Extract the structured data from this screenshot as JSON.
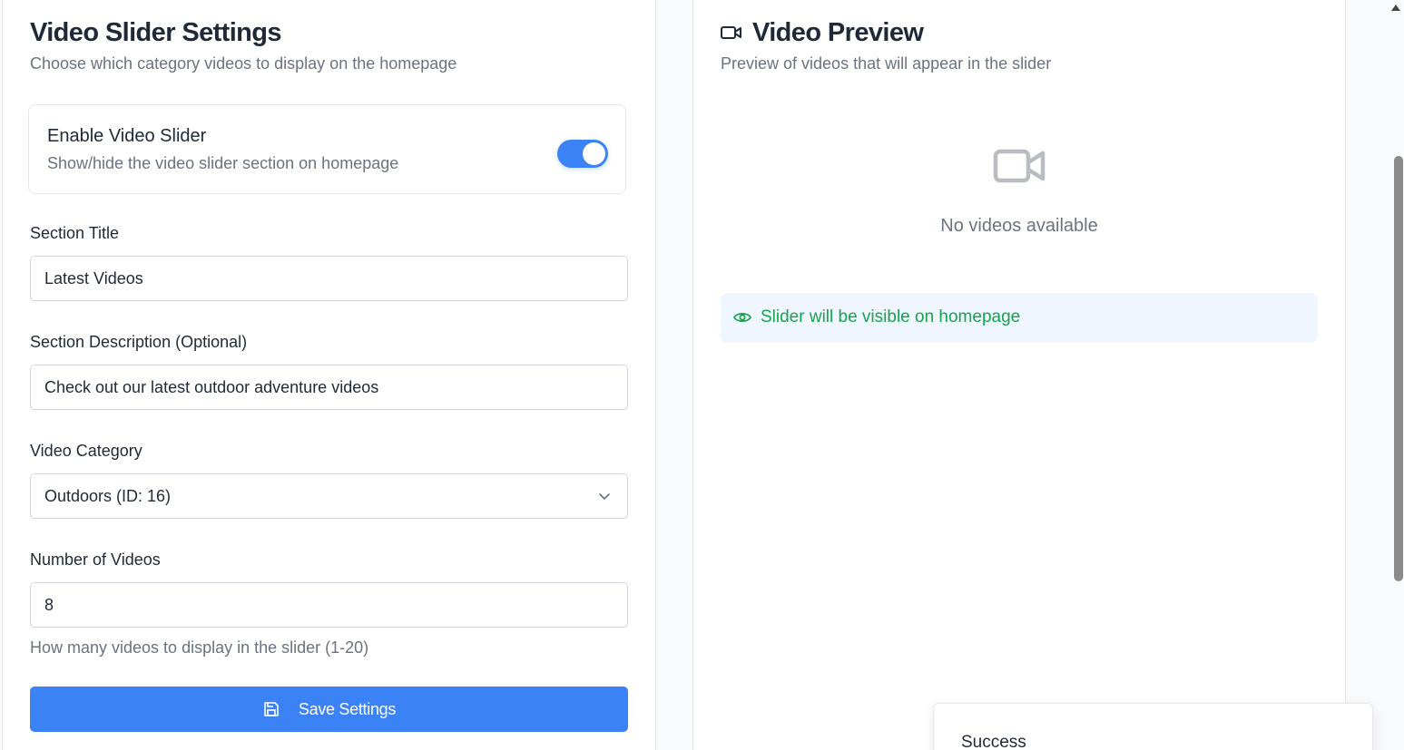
{
  "settings": {
    "title": "Video Slider Settings",
    "subtitle": "Choose which category videos to display on the homepage",
    "enable": {
      "title": "Enable Video Slider",
      "description": "Show/hide the video slider section on homepage",
      "enabled": true
    },
    "section_title": {
      "label": "Section Title",
      "value": "Latest Videos"
    },
    "section_description": {
      "label": "Section Description (Optional)",
      "value": "Check out our latest outdoor adventure videos"
    },
    "video_category": {
      "label": "Video Category",
      "selected": "Outdoors (ID: 16)"
    },
    "number_of_videos": {
      "label": "Number of Videos",
      "value": "8",
      "help": "How many videos to display in the slider (1-20)"
    },
    "save_label": "Save Settings"
  },
  "preview": {
    "title": "Video Preview",
    "subtitle": "Preview of videos that will appear in the slider",
    "empty_text": "No videos available",
    "visibility_note": "Slider will be visible on homepage"
  },
  "toast": {
    "title": "Success"
  },
  "colors": {
    "accent": "#3b82f6",
    "success": "#16a34a",
    "muted_text": "#6b7280",
    "info_bg": "#eff6ff"
  },
  "icons": {
    "preview_header": "video-camera-icon",
    "empty_state": "video-camera-icon",
    "visibility": "eye-icon",
    "save": "floppy-disk-icon",
    "select": "chevron-down-icon"
  }
}
